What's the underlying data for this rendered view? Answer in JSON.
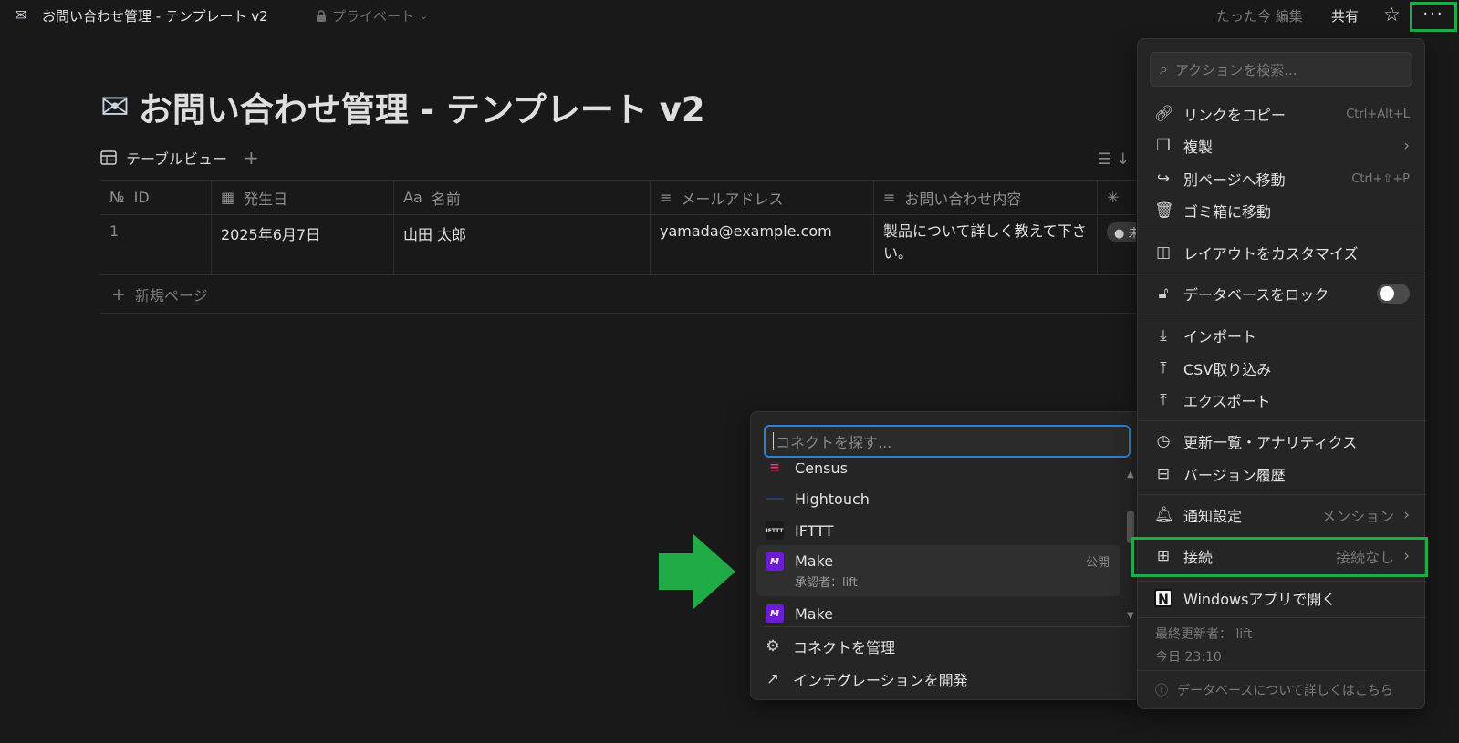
{
  "topbar": {
    "title": "お問い合わせ管理 - テンプレート v2",
    "privacy": "プライベート",
    "edited": "たった今 編集",
    "share": "共有",
    "more": "···"
  },
  "page": {
    "title": "お問い合わせ管理 - テンプレート v2",
    "view_tab": "テーブルビュー"
  },
  "table": {
    "headers": [
      "ID",
      "発生日",
      "名前",
      "メールアドレス",
      "お問い合わせ内容"
    ],
    "header_prefix": [
      "№",
      "",
      "Aa",
      "",
      ""
    ],
    "rows": [
      {
        "id": "1",
        "date": "2025年6月7日",
        "name": "山田 太郎",
        "email": "yamada@example.com",
        "message": "製品について詳しく教えて下さい。",
        "status": "未"
      }
    ],
    "new_page": "新規ページ"
  },
  "menu": {
    "search_placeholder": "アクションを検索...",
    "items": [
      {
        "label": "リンクをコピー",
        "shortcut": "Ctrl+Alt+L",
        "icon": "link-icon"
      },
      {
        "label": "複製",
        "icon": "duplicate-icon"
      },
      {
        "label": "別ページへ移動",
        "shortcut": "Ctrl+⇧+P",
        "icon": "move-icon"
      },
      {
        "label": "ゴミ箱に移動",
        "icon": "trash-icon"
      },
      {
        "label": "レイアウトをカスタマイズ",
        "icon": "layout-icon"
      },
      {
        "label": "データベースをロック",
        "icon": "lock-icon"
      },
      {
        "label": "インポート",
        "icon": "import-icon"
      },
      {
        "label": "CSV取り込み",
        "icon": "csv-icon"
      },
      {
        "label": "エクスポート",
        "icon": "export-icon"
      },
      {
        "label": "更新一覧・アナリティクス",
        "icon": "clock-icon"
      },
      {
        "label": "バージョン履歴",
        "icon": "history-icon"
      },
      {
        "label": "通知設定",
        "value": "メンション",
        "icon": "bell-icon"
      },
      {
        "label": "接続",
        "value": "接続なし",
        "icon": "grid-icon"
      },
      {
        "label": "Windowsアプリで開く",
        "icon": "notion-icon"
      }
    ],
    "last_edited_by": "最終更新者： lift",
    "last_edited_time": "今日 23:10",
    "help": "データベースについて詳しくはこちら"
  },
  "connect_popup": {
    "search_placeholder": "コネクトを探す...",
    "items": [
      {
        "name": "Census"
      },
      {
        "name": "Hightouch"
      },
      {
        "name": "IFTTT",
        "logo_text": "IFTTT"
      },
      {
        "name": "Make",
        "sub": "承認者：lift",
        "badge": "公開",
        "logo_text": "M"
      },
      {
        "name": "Make",
        "logo_text": "M"
      }
    ],
    "manage": "コネクトを管理",
    "develop": "インテグレーションを開発"
  },
  "colors": {
    "background": "#191919",
    "menu_bg": "#252525",
    "highlight": "#1fab45",
    "focus_blue": "#2e7fd6",
    "make_purple": "#6d1bd6"
  }
}
